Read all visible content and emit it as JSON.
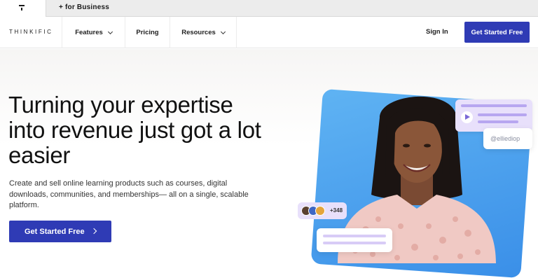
{
  "topbar": {
    "business_link": "+ for Business"
  },
  "nav": {
    "logo": "THINKIFIC",
    "items": [
      {
        "label": "Features",
        "has_dropdown": true
      },
      {
        "label": "Pricing",
        "has_dropdown": false
      },
      {
        "label": "Resources",
        "has_dropdown": true
      }
    ],
    "signin": "Sign In",
    "cta": "Get Started Free"
  },
  "hero": {
    "headline": "Turning your expertise into revenue just got a lot easier",
    "subtext": "Create and sell online learning products such as courses, digital downloads, communities, and memberships— all on a single, scalable platform.",
    "cta": "Get Started Free",
    "creator_handle": "@elliediop",
    "avatar_count": "+348"
  },
  "colors": {
    "brand": "#2f3bb5",
    "card_blue": "#4a9ff0",
    "lavender": "#e8e0fb"
  }
}
